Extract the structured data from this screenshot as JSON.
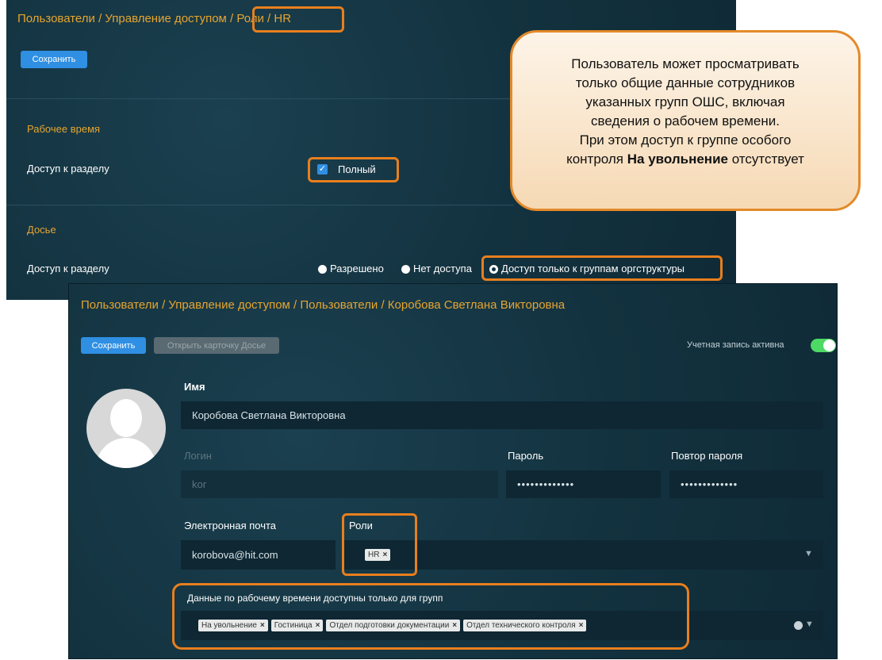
{
  "top_panel": {
    "breadcrumb": "Пользователи / Управление доступом / Роли / HR",
    "save_label": "Сохранить",
    "work_time": {
      "section_title": "Рабочее время",
      "access_label": "Доступ к разделу",
      "checkbox_label": "Полный"
    },
    "dossier": {
      "section_title": "Досье",
      "access_label": "Доступ к разделу",
      "options": [
        "Разрешено",
        "Нет доступа",
        "Доступ только к группам оргструктуры"
      ],
      "selected": "Доступ только к группам оргструктуры"
    }
  },
  "callout": {
    "line1": "Пользователь может просматривать",
    "line2": "только общие данные сотрудников",
    "line3": "указанных групп ОШС, включая",
    "line4": "сведения о рабочем времени.",
    "line5": "При этом доступ к группе особого",
    "line6_prefix": "контроля ",
    "line6_bold": "На увольнение",
    "line6_suffix": " отсутствует"
  },
  "bottom_panel": {
    "breadcrumb": "Пользователи / Управление доступом / Пользователи / Коробова Светлана Викторовна",
    "save_label": "Сохранить",
    "open_dossier_label": "Открыть карточку Досье",
    "account_active_label": "Учетная запись активна",
    "account_active": true,
    "name_label": "Имя",
    "name_value": "Коробова Светлана Викторовна",
    "login_label": "Логин",
    "login_value": "kor",
    "password_label": "Пароль",
    "password_value": "•••••••••••••",
    "password_repeat_label": "Повтор пароля",
    "password_repeat_value": "•••••••••••••",
    "email_label": "Электронная почта",
    "email_value": "korobova@hit.com",
    "roles_label": "Роли",
    "roles": [
      "HR"
    ],
    "groups_label": "Данные по рабочему времени доступны только для групп",
    "groups": [
      "На увольнение",
      "Гостиница",
      "Отдел подготовки документации",
      "Отдел технического контроля"
    ]
  },
  "colors": {
    "panel_bg": "#13323f",
    "accent_orange": "#e6a52f",
    "highlight": "#e87f1e",
    "button_blue": "#2f8fe3",
    "toggle_green": "#4cd964"
  }
}
